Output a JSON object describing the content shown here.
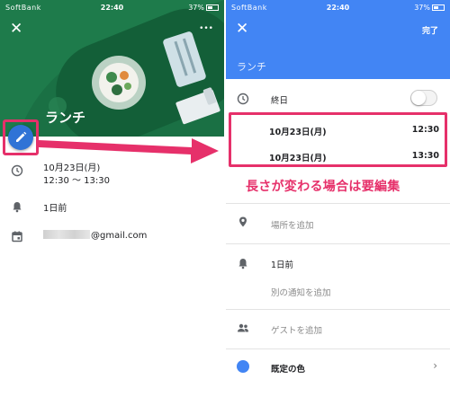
{
  "status_bar": {
    "carrier": "SoftBank",
    "time": "22:40",
    "battery": "37%"
  },
  "left_screen": {
    "close_label": "✕",
    "more_label": "•••",
    "event_title": "ランチ",
    "date_line": "10月23日(月)",
    "time_range": "12:30 ～ 13:30",
    "reminder": "1日前",
    "email_suffix": "@gmail.com"
  },
  "right_screen": {
    "close_label": "✕",
    "done_label": "完了",
    "title": "ランチ",
    "all_day_label": "終日",
    "all_day_enabled": false,
    "start_date": "10月23日(月)",
    "start_time": "12:30",
    "end_date": "10月23日(月)",
    "end_time": "13:30",
    "location_placeholder": "場所を追加",
    "reminder": "1日前",
    "add_reminder": "別の通知を追加",
    "add_guest": "ゲストを追加",
    "color_label": "既定の色",
    "color_value": "#4285f4"
  },
  "annotation": {
    "callout": "長さが変わる場合は要編集",
    "highlight_color": "#e6306a"
  }
}
